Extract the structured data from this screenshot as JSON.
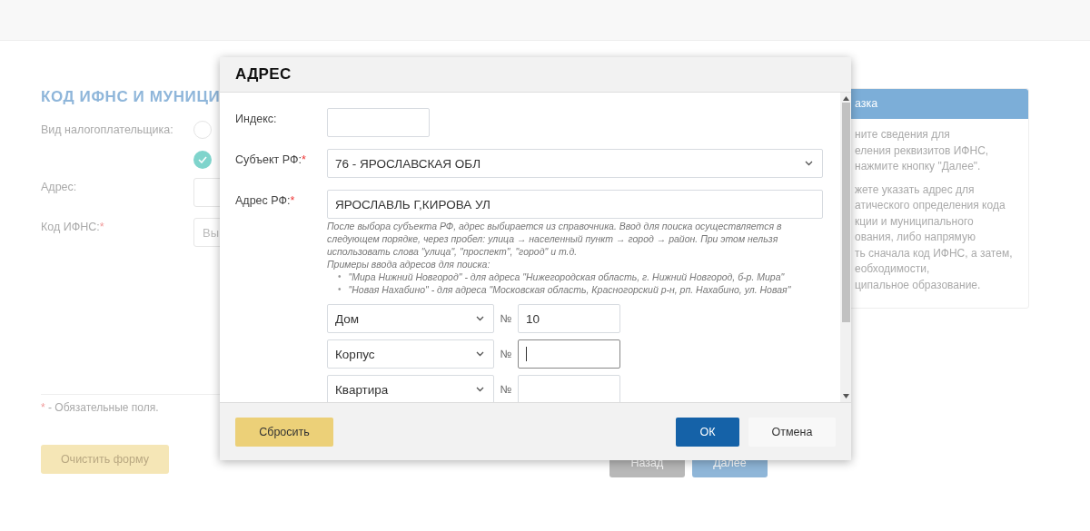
{
  "page": {
    "title": "КОД ИФНС И МУНИЦИ",
    "fields": [
      {
        "kind": "radio",
        "label": "Вид налогоплательщика:",
        "options": [
          {
            "selected": false
          },
          {
            "selected": true
          }
        ]
      },
      {
        "kind": "input",
        "label": "Адрес:"
      },
      {
        "kind": "input",
        "label": "Код ИФНС:",
        "required_mark": "*",
        "placeholder": "Вы"
      }
    ],
    "required_note": {
      "mark": "*",
      "text": " - Обязательные поля."
    },
    "buttons": [
      {
        "kind": "clear",
        "label": "Очистить форму",
        "disabled": false
      },
      {
        "kind": "back",
        "label": "Назад",
        "disabled": true
      },
      {
        "kind": "next",
        "label": "Далее",
        "disabled": false
      }
    ],
    "hint": {
      "title": "азка",
      "paragraphs": [
        [
          "ните сведения для",
          "еления реквизитов ИФНС,",
          "нажмите кнопку \"Далее\"."
        ],
        [
          "жете указать адрес для",
          "атического определения кода",
          "кции и муниципального",
          "ования, либо напрямую",
          "ть сначала код ИФНС, а затем,",
          "еобходимости,",
          "ципальное образование."
        ]
      ]
    }
  },
  "dialog": {
    "title": "АДРЕС",
    "fields": [
      {
        "kind": "input",
        "label": "Индекс:"
      },
      {
        "kind": "select",
        "label": "Субъект РФ:",
        "required_mark": "*",
        "value": "76 - ЯРОСЛАВСКАЯ ОБЛ"
      },
      {
        "kind": "input",
        "label": "Адрес РФ:",
        "required_mark": "*",
        "value": "ЯРОСЛАВЛЬ Г,КИРОВА УЛ"
      }
    ],
    "help": {
      "lines": [
        "После выбора субъекта РФ, адрес выбирается из справочника. Ввод для поиска осуществляется в следующем порядке, через пробел: улица → населенный пункт → город → район. При этом нельзя использовать слова \"улица\", \"проспект\", \"город\" и т.д.",
        "Примеры ввода адресов для поиска:"
      ],
      "examples": [
        {
          "bullet": "•",
          "text": "\"Мира Нижний Новгород\" - для адреса \"Нижегородская область, г. Нижний Новгород, б-р. Мира\""
        },
        {
          "bullet": "•",
          "text": "\"Новая Нахабино\" - для адреса \"Московская область, Красногорский р-н, рп. Нахабино, ул. Новая\""
        }
      ]
    },
    "parts": [
      {
        "type": "Дом",
        "number_sign": "№",
        "value": "10",
        "focused": false
      },
      {
        "type": "Корпус",
        "number_sign": "№",
        "focused": true
      },
      {
        "type": "Квартира",
        "number_sign": "№",
        "focused": false
      }
    ],
    "buttons": [
      {
        "kind": "reset",
        "label": "Сбросить"
      },
      {
        "kind": "ok",
        "label": "ОК"
      },
      {
        "kind": "cancel",
        "label": "Отмена"
      }
    ]
  }
}
